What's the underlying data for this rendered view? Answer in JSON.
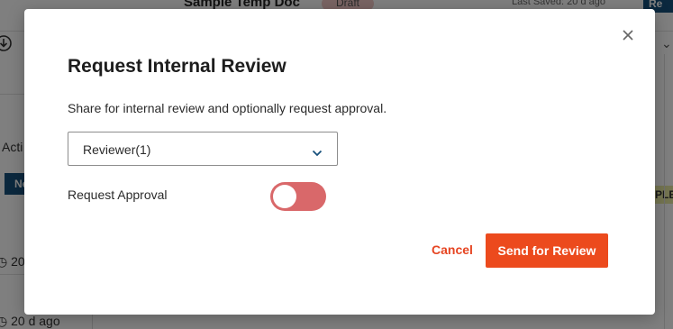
{
  "background": {
    "doc_title": "Sample Temp Doc",
    "status_badge": "Draft",
    "last_saved": "Last Saved: 20 d ago",
    "review_button": "Re",
    "activity_label": "Acti",
    "nav_button": "Ne",
    "timestamp_1": "20",
    "timestamp_2": "20 d ago",
    "sample_label": "PLE"
  },
  "modal": {
    "title": "Request Internal Review",
    "description": "Share for internal review and optionally request approval.",
    "reviewer_select": {
      "value": "Reviewer(1)"
    },
    "approval_toggle": {
      "label": "Request Approval",
      "state": "off"
    },
    "cancel_label": "Cancel",
    "send_label": "Send for Review"
  },
  "colors": {
    "accent_orange": "#ec4a1d",
    "toggle_red": "#d9686a",
    "brand_blue": "#17507c"
  },
  "icons": {
    "close": "close-icon",
    "chevron": "chevron-down-icon",
    "download": "download-icon",
    "clock": "clock-icon"
  }
}
